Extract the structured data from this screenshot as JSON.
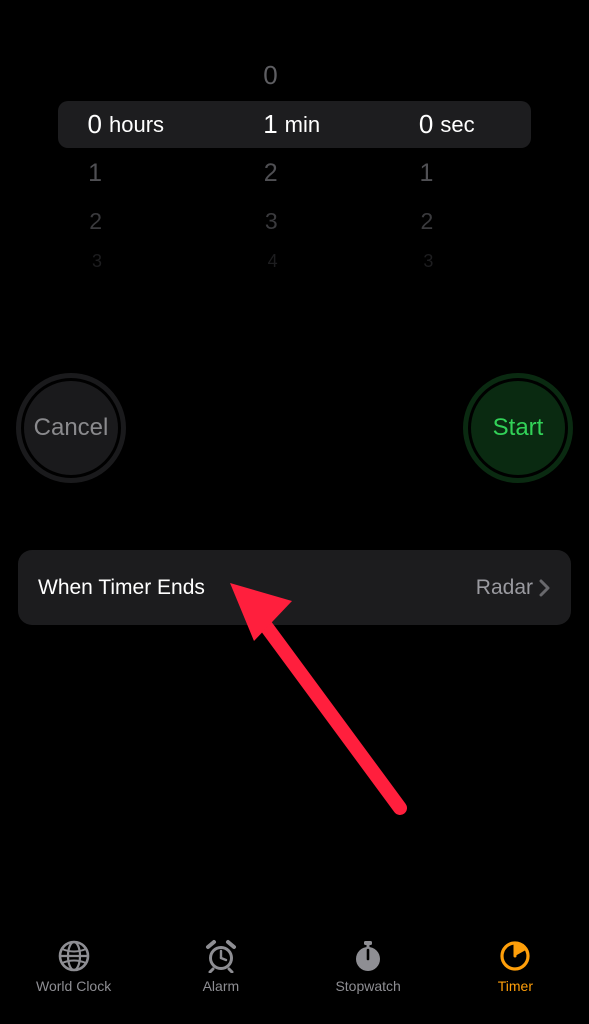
{
  "picker": {
    "hours": {
      "selected": "0",
      "unit": "hours",
      "below": [
        "1",
        "2",
        "3"
      ]
    },
    "minutes": {
      "above": "0",
      "selected": "1",
      "unit": "min",
      "below": [
        "2",
        "3",
        "4"
      ]
    },
    "seconds": {
      "selected": "0",
      "unit": "sec",
      "below": [
        "1",
        "2",
        "3"
      ]
    }
  },
  "buttons": {
    "cancel": "Cancel",
    "start": "Start"
  },
  "option": {
    "title": "When Timer Ends",
    "value": "Radar"
  },
  "tabs": {
    "world_clock": "World Clock",
    "alarm": "Alarm",
    "stopwatch": "Stopwatch",
    "timer": "Timer"
  }
}
